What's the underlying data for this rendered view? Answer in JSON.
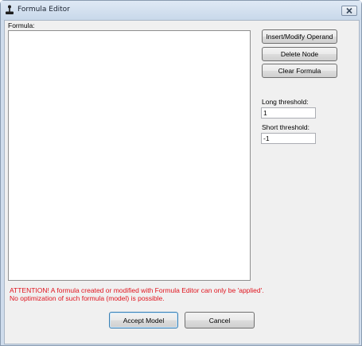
{
  "window": {
    "title": "Formula Editor"
  },
  "formula": {
    "label": "Formula:"
  },
  "buttons": {
    "insert_modify": "Insert/Modify Operand",
    "delete_node": "Delete Node",
    "clear_formula": "Clear Formula",
    "accept": "Accept Model",
    "cancel": "Cancel"
  },
  "thresholds": {
    "long_label": "Long threshold:",
    "long_value": "1",
    "short_label": "Short threshold:",
    "short_value": "-1"
  },
  "attention": {
    "line1": "ATTENTION! A formula created or modified with Formula Editor can only be 'applied'.",
    "line2": "No optimization of such formula (model) is possible."
  },
  "icons": {
    "app": "joystick-icon",
    "close": "close-icon"
  }
}
